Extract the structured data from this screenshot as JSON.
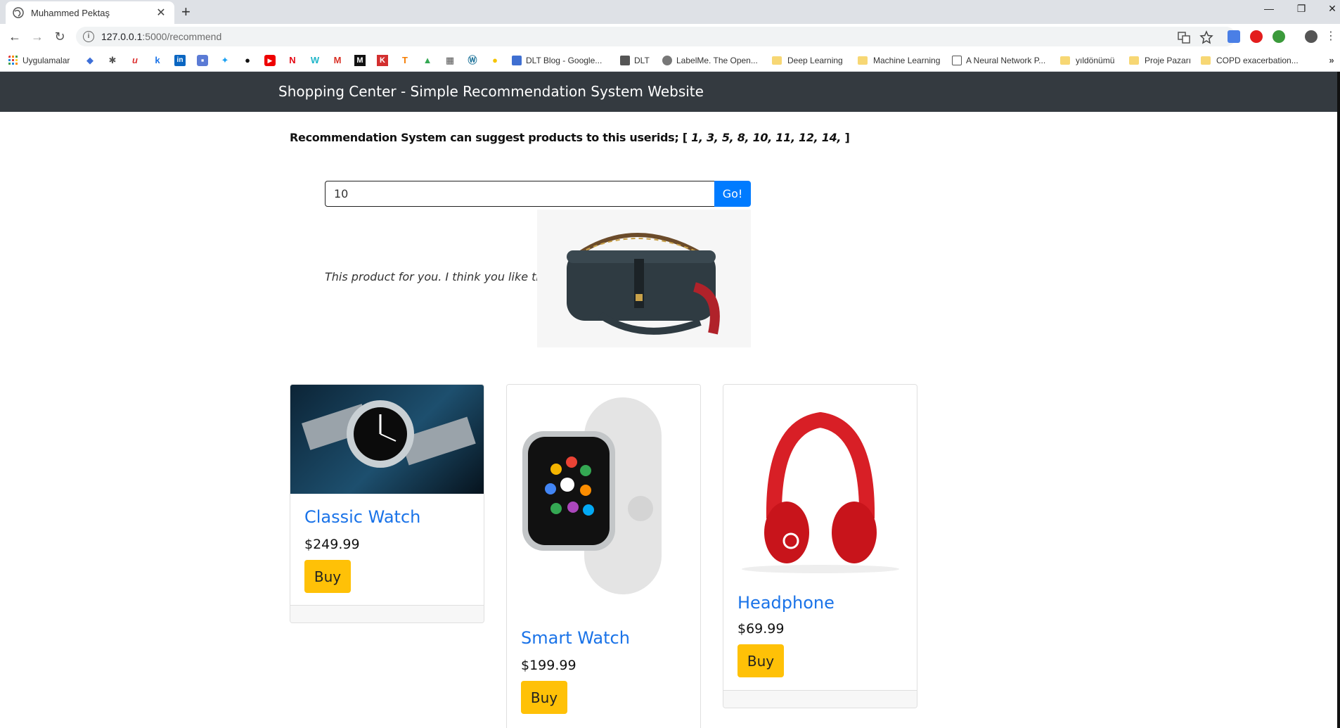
{
  "browser": {
    "tab_title": "Muhammed Pektaş",
    "url_host": "127.0.0.1",
    "url_path": ":5000/recommend",
    "bookmarks": {
      "apps_label": "Uygulamalar",
      "dlt_blog": "DLT Blog - Google...",
      "dlt": "DLT",
      "labelme": "LabelMe. The Open...",
      "deep_learning": "Deep Learning",
      "machine_learning": "Machine Learning",
      "neural_network": "A Neural Network P...",
      "yildonumu": "yıldönümü",
      "proje_pazari": "Proje Pazarı",
      "copd": "COPD exacerbation..."
    }
  },
  "navbar": {
    "brand": "Shopping Center - Simple Recommendation System Website"
  },
  "recommend": {
    "users_prefix": "Recommendation System can suggest products to this userids; [ ",
    "user_ids": "1, 3, 5, 8, 10, 11, 12, 14,",
    "users_suffix": " ]",
    "user_input_value": "10",
    "go_label": "Go!",
    "suggest_text": "This product for you. I think you like that. :*"
  },
  "products": [
    {
      "title": "Classic Watch",
      "price": "$249.99",
      "buy_label": "Buy"
    },
    {
      "title": "Smart Watch",
      "price": "$199.99",
      "buy_label": "Buy"
    },
    {
      "title": "Headphone",
      "price": "$69.99",
      "buy_label": "Buy"
    }
  ],
  "colors": {
    "navbar_bg": "#343a40",
    "accent_blue": "#007bff",
    "buy_yellow": "#ffc107"
  }
}
